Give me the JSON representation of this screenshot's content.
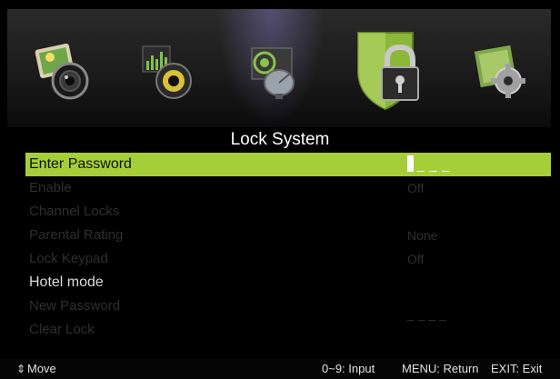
{
  "tabs": [
    {
      "icon": "picture-icon"
    },
    {
      "icon": "sound-icon"
    },
    {
      "icon": "channel-icon"
    },
    {
      "icon": "lock-icon"
    },
    {
      "icon": "setup-icon"
    }
  ],
  "title": "Lock System",
  "menu": {
    "items": [
      {
        "label": "Enter Password",
        "value": "_ _ _"
      },
      {
        "label": "Enable",
        "value": "Off"
      },
      {
        "label": "Channel Locks",
        "value": ""
      },
      {
        "label": "Parental Rating",
        "value": "None"
      },
      {
        "label": "Lock Keypad",
        "value": "Off"
      },
      {
        "label": "Hotel mode",
        "value": ""
      },
      {
        "label": "New Password",
        "value": "_ _ _ _"
      },
      {
        "label": "Clear Lock",
        "value": ""
      }
    ]
  },
  "footer": {
    "move": "Move",
    "input": "0~9: Input",
    "return": "MENU: Return",
    "exit": "EXIT: Exit"
  },
  "colors": {
    "highlight": "#a6ce39",
    "background": "#000000",
    "dim_text": "#2f2f2f"
  }
}
